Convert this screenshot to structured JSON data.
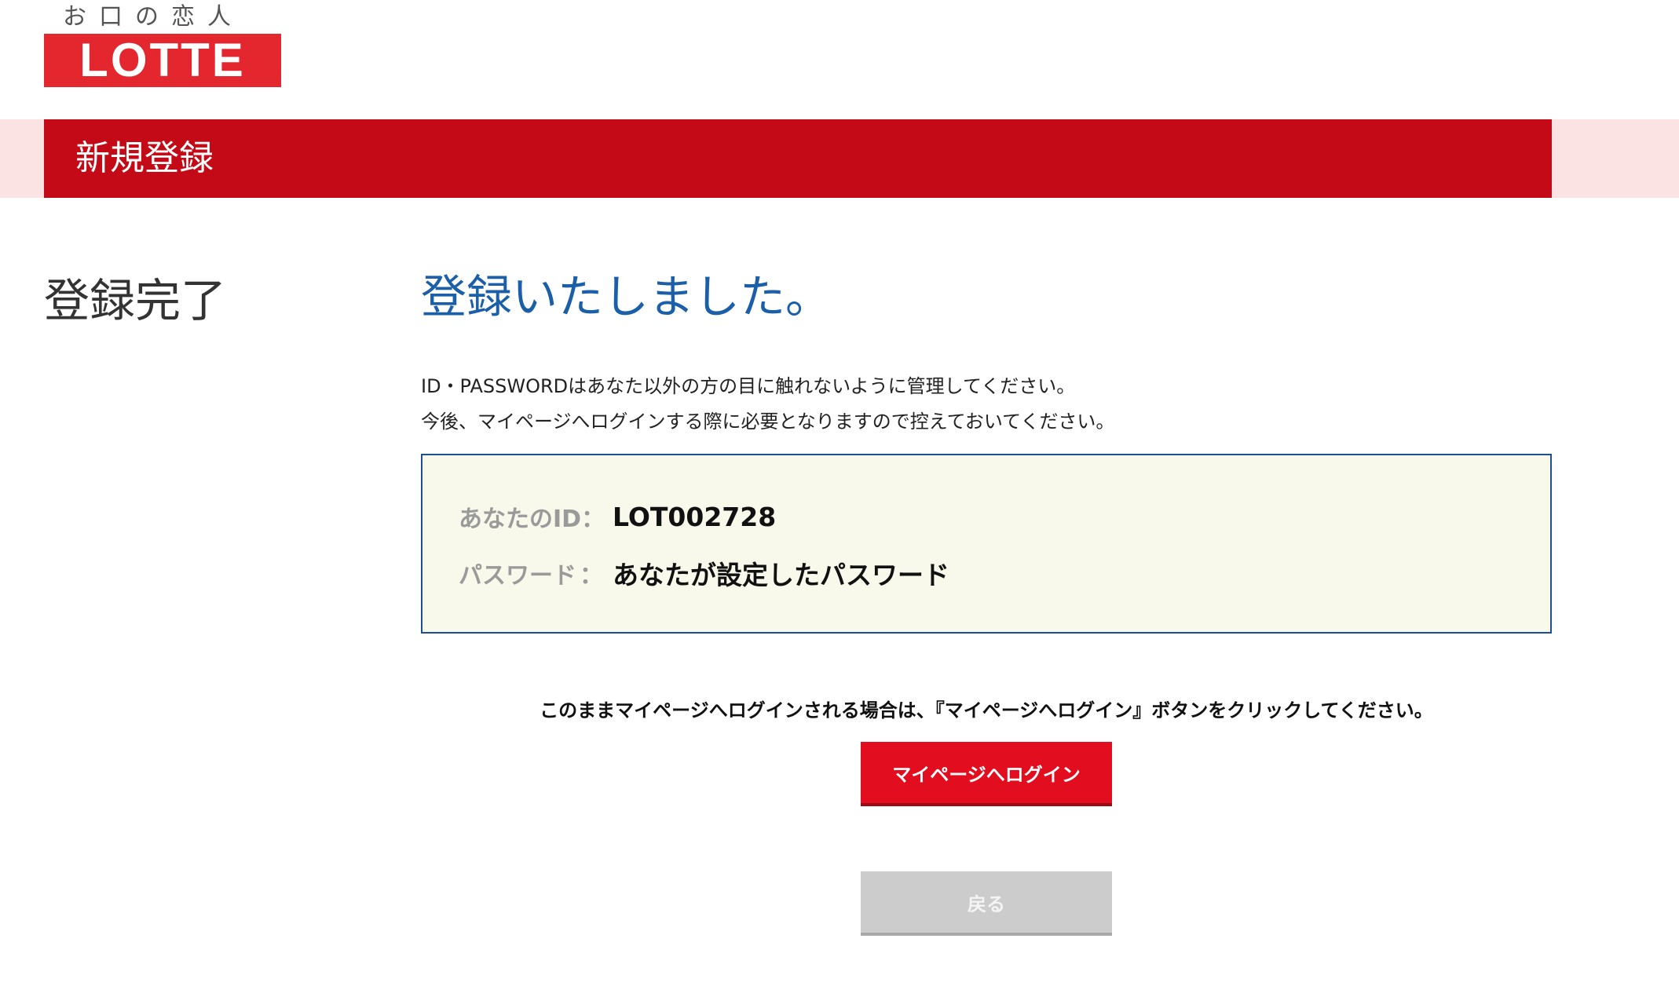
{
  "header": {
    "tagline": "お口の恋人",
    "logo_text": "LOTTE",
    "brand_color": "#e4262f"
  },
  "band": {
    "title": "新規登録",
    "color": "#c30a16",
    "background": "#fbe3e4"
  },
  "section": {
    "title": "登録完了"
  },
  "main": {
    "heading": "登録いたしました。",
    "heading_color": "#1b5fa8",
    "notice_lines": [
      "ID・PASSWORDはあなた以外の方の目に触れないように管理してください。",
      "今後、マイページへログインする際に必要となりますので控えておいてください。"
    ],
    "info": {
      "id_label": "あなたのID",
      "separator": "：",
      "id_value": "LOT002728",
      "password_label": "パスワード",
      "password_value": "あなたが設定したパスワード"
    },
    "instruction": "このままマイページへログインされる場合は、『マイページへログイン』ボタンをクリックしてください。",
    "login_button": "マイページへログイン",
    "back_button": "戻る"
  }
}
